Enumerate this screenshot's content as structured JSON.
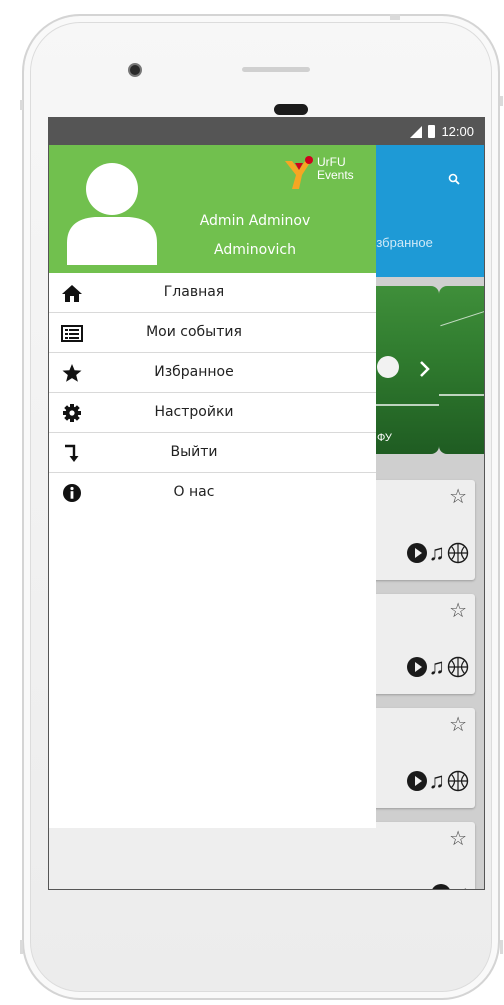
{
  "status_bar": {
    "time": "12:00"
  },
  "app_logo": {
    "line1": "UrFU",
    "line2": "Events"
  },
  "user": {
    "first_line": "Admin Adminov",
    "second_line": "Adminovich"
  },
  "menu": {
    "items": [
      {
        "label": "Главная",
        "icon": "home-icon"
      },
      {
        "label": "Мои события",
        "icon": "list-icon"
      },
      {
        "label": "Избранное",
        "icon": "star-icon"
      },
      {
        "label": "Настройки",
        "icon": "gear-icon"
      },
      {
        "label": "Выйти",
        "icon": "exit-arrow-icon"
      },
      {
        "label": "О нас",
        "icon": "info-icon"
      }
    ]
  },
  "background_app": {
    "tab_partial": "Избранное",
    "card_text_partial": "ФУ",
    "event_card_fragment": "у"
  },
  "colors": {
    "drawer_header": "#71c04e",
    "appbar": "#1e9ad6",
    "status_bar": "#555555"
  }
}
